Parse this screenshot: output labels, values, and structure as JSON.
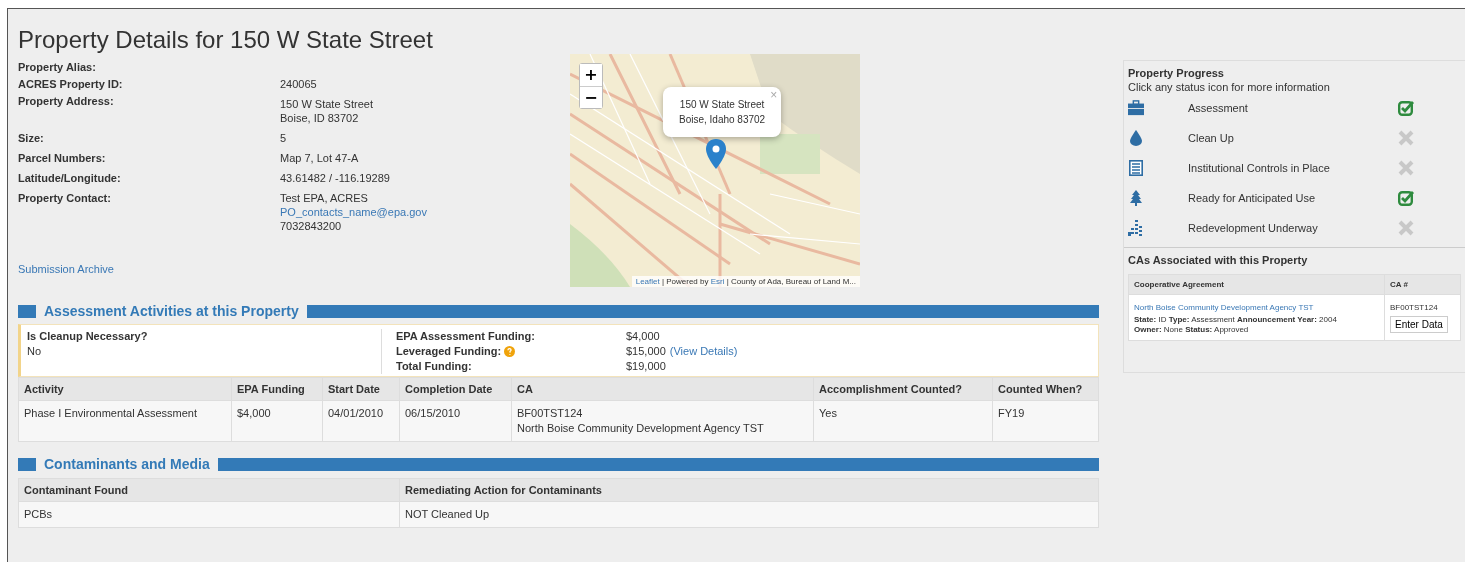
{
  "page_title": "Property Details for 150 W State Street",
  "details": [
    {
      "label": "Property Alias:"
    },
    {
      "label": "ACRES Property ID:",
      "values": [
        {
          "text": "240065",
          "kind": "text"
        }
      ]
    },
    {
      "label": "Property Address:",
      "values": [
        {
          "text": "150 W State Street",
          "kind": "text"
        },
        {
          "text": "Boise, ID 83702",
          "kind": "text"
        }
      ]
    },
    {
      "label": "Size:",
      "values": [
        {
          "text": "5",
          "kind": "text"
        }
      ]
    },
    {
      "label": "Parcel Numbers:",
      "values": [
        {
          "text": "Map 7, Lot 47-A",
          "kind": "text"
        }
      ]
    },
    {
      "label": "Latitude/Longitude:",
      "values": [
        {
          "text": "43.61482 / -116.19289",
          "kind": "text"
        }
      ]
    },
    {
      "label": "Property Contact:",
      "values": [
        {
          "text": "Test EPA, ACRES",
          "kind": "text"
        },
        {
          "text": "PO_contacts_name@epa.gov",
          "kind": "link"
        },
        {
          "text": "7032843200",
          "kind": "text"
        }
      ]
    }
  ],
  "submission_archive_link": "Submission Archive",
  "map": {
    "zoom_in": "+",
    "zoom_out": "−",
    "popup": [
      "150 W State Street",
      "Boise, Idaho 83702"
    ],
    "popup_close": "×",
    "attribution": [
      {
        "text": "Leaflet",
        "kind": "link"
      },
      {
        "text": " | Powered by ",
        "kind": "text"
      },
      {
        "text": "Esri",
        "kind": "link"
      },
      {
        "text": " | County of Ada, Bureau of Land M...",
        "kind": "text"
      }
    ]
  },
  "assessment": {
    "title": "Assessment Activities at this Property",
    "cleanup_label": "Is Cleanup Necessary?",
    "cleanup_value": "No",
    "funding": [
      {
        "label": "EPA Assessment Funding:",
        "value": "$4,000",
        "info": false
      },
      {
        "label": "Leveraged Funding:",
        "value": "$15,000",
        "info": true,
        "link": "(View Details)"
      },
      {
        "label": "Total Funding:",
        "value": "$19,000",
        "info": false
      }
    ],
    "columns": [
      "Activity",
      "EPA Funding",
      "Start Date",
      "Completion Date",
      "CA",
      "Accomplishment Counted?",
      "Counted When?"
    ],
    "rows": [
      [
        [
          "Phase I Environmental Assessment"
        ],
        [
          "$4,000"
        ],
        [
          "04/01/2010"
        ],
        [
          "06/15/2010"
        ],
        [
          "BF00TST124",
          "North Boise Community Development Agency TST"
        ],
        [
          "Yes"
        ],
        [
          "FY19"
        ]
      ]
    ]
  },
  "contaminants": {
    "title": "Contaminants and Media",
    "columns": [
      "Contaminant Found",
      "Remediating Action for Contaminants"
    ],
    "rows": [
      [
        "PCBs",
        "NOT Cleaned Up"
      ]
    ]
  },
  "progress": {
    "title": "Property Progress",
    "hint": "Click any status icon for more information",
    "items": [
      {
        "kind": "briefcase",
        "label": "Assessment",
        "done": true
      },
      {
        "kind": "drop",
        "label": "Clean Up",
        "done": false
      },
      {
        "kind": "list",
        "label": "Institutional Controls in Place",
        "done": false
      },
      {
        "kind": "tree",
        "label": "Ready for Anticipated Use",
        "done": true
      },
      {
        "kind": "chart",
        "label": "Redevelopment Underway",
        "done": false
      }
    ]
  },
  "cas": {
    "title": "CAs Associated with this Property",
    "columns": [
      "Cooperative Agreement",
      "CA #"
    ],
    "rows": [
      {
        "name": "North Boise Community Development Agency TST",
        "info": [
          "**State:** ID **Type:** Assessment **Announcement Year:** 2004",
          "**Owner:** None **Status:** Approved"
        ],
        "number": "BF00TST124",
        "button": "Enter Data"
      }
    ]
  }
}
